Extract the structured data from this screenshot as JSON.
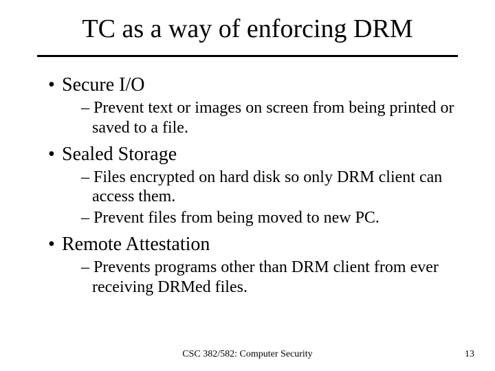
{
  "title": "TC as a way of enforcing DRM",
  "bullets": [
    {
      "label": "Secure I/O",
      "subs": [
        "Prevent text or images on screen from being printed or saved to a file."
      ]
    },
    {
      "label": "Sealed Storage",
      "subs": [
        "Files encrypted on hard disk so only DRM client can access them.",
        "Prevent files from being moved to new PC."
      ]
    },
    {
      "label": "Remote Attestation",
      "subs": [
        "Prevents programs other than DRM client from ever receiving DRMed files."
      ]
    }
  ],
  "footer": {
    "center": "CSC 382/582: Computer Security",
    "pagenum": "13"
  },
  "glyphs": {
    "bullet": "•",
    "dash": "–"
  }
}
